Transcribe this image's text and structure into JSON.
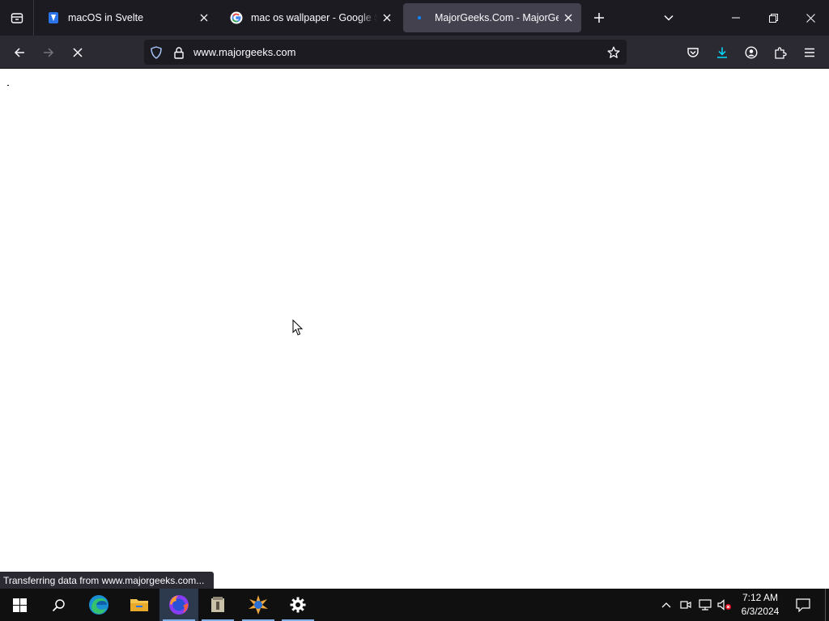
{
  "browser": {
    "tabs": [
      {
        "title": "macOS in Svelte",
        "favicon": "svelte-logo-icon",
        "active": false
      },
      {
        "title": "mac os wallpaper - Google Search",
        "favicon": "google-g-icon",
        "active": false
      },
      {
        "title": "MajorGeeks.Com - MajorGeeks",
        "favicon": "loading-dot-icon",
        "active": true
      }
    ],
    "url": "www.majorgeeks.com",
    "status_text": "Transferring data from www.majorgeeks.com...",
    "loading": true
  },
  "taskbar": {
    "apps": [
      "start-icon",
      "search-icon",
      "edge-icon",
      "file-explorer-icon",
      "firefox-icon",
      "archive-app-icon",
      "tools-app-icon",
      "settings-icon"
    ],
    "clock": {
      "time": "7:12 AM",
      "date": "6/3/2024"
    }
  },
  "colors": {
    "tabstrip_bg": "#1c1b22",
    "navbar_bg": "#2b2a33",
    "active_tab_bg": "#42414d",
    "download_accent": "#00ddff",
    "taskbar_bg": "#101010"
  }
}
